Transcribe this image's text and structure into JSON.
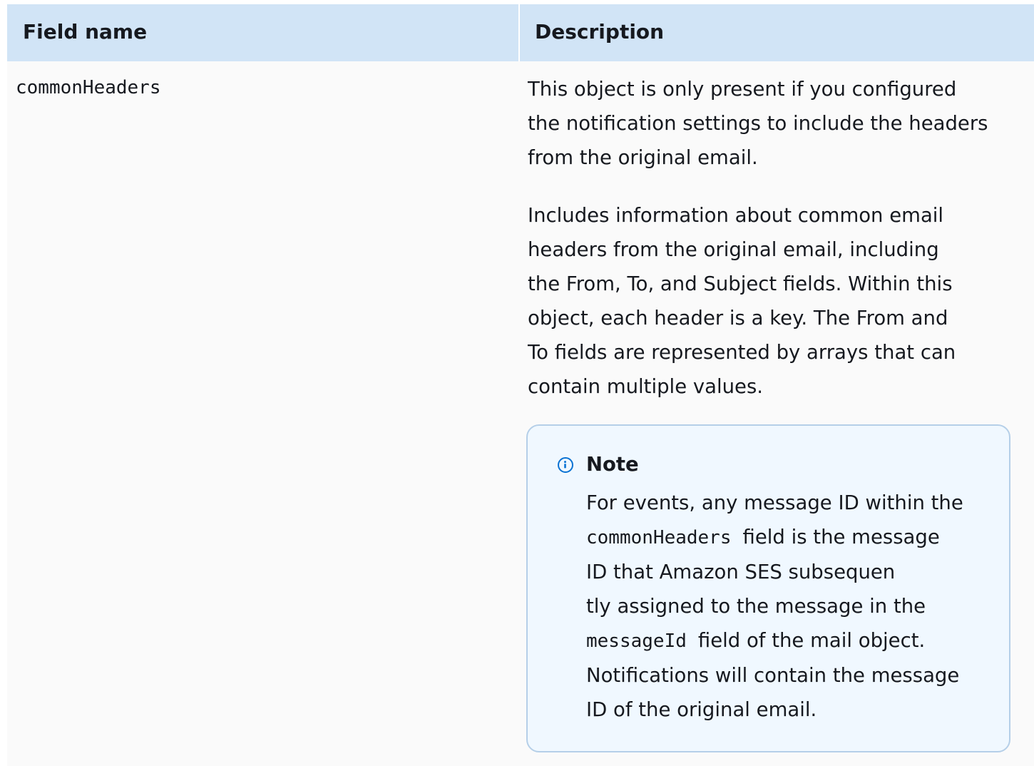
{
  "table": {
    "headers": [
      "Field name",
      "Description"
    ],
    "rows": [
      {
        "field_name": "commonHeaders",
        "description": {
          "paragraph1_lines": [
            "This object is only present if you configured",
            "the notification settings to include the headers",
            "from the original email."
          ],
          "paragraph2_lines": [
            "Includes information about common email",
            "headers from the original email, including",
            "the From, To, and Subject fields. Within this",
            "object, each header is a key. The From and",
            "To fields are represented by arrays that can",
            "contain multiple values."
          ]
        },
        "note": {
          "icon": "info-icon",
          "title": "Note",
          "line1": "For events, any message ID within the",
          "line2_code": "commonHeaders",
          "line2_text": "field is the message",
          "line3": "ID that Amazon SES subsequen",
          "line4": "tly assigned to the message in the",
          "line5_code": "messageId",
          "line5_text": "field of the mail object.",
          "line6": "Notifications will contain the message",
          "line7": "ID of the original email."
        }
      }
    ]
  },
  "colors": {
    "header_bg": "#d1e4f6",
    "note_border": "#b5cfe8",
    "note_bg": "#f0f8ff",
    "info_icon": "#0972d3"
  }
}
